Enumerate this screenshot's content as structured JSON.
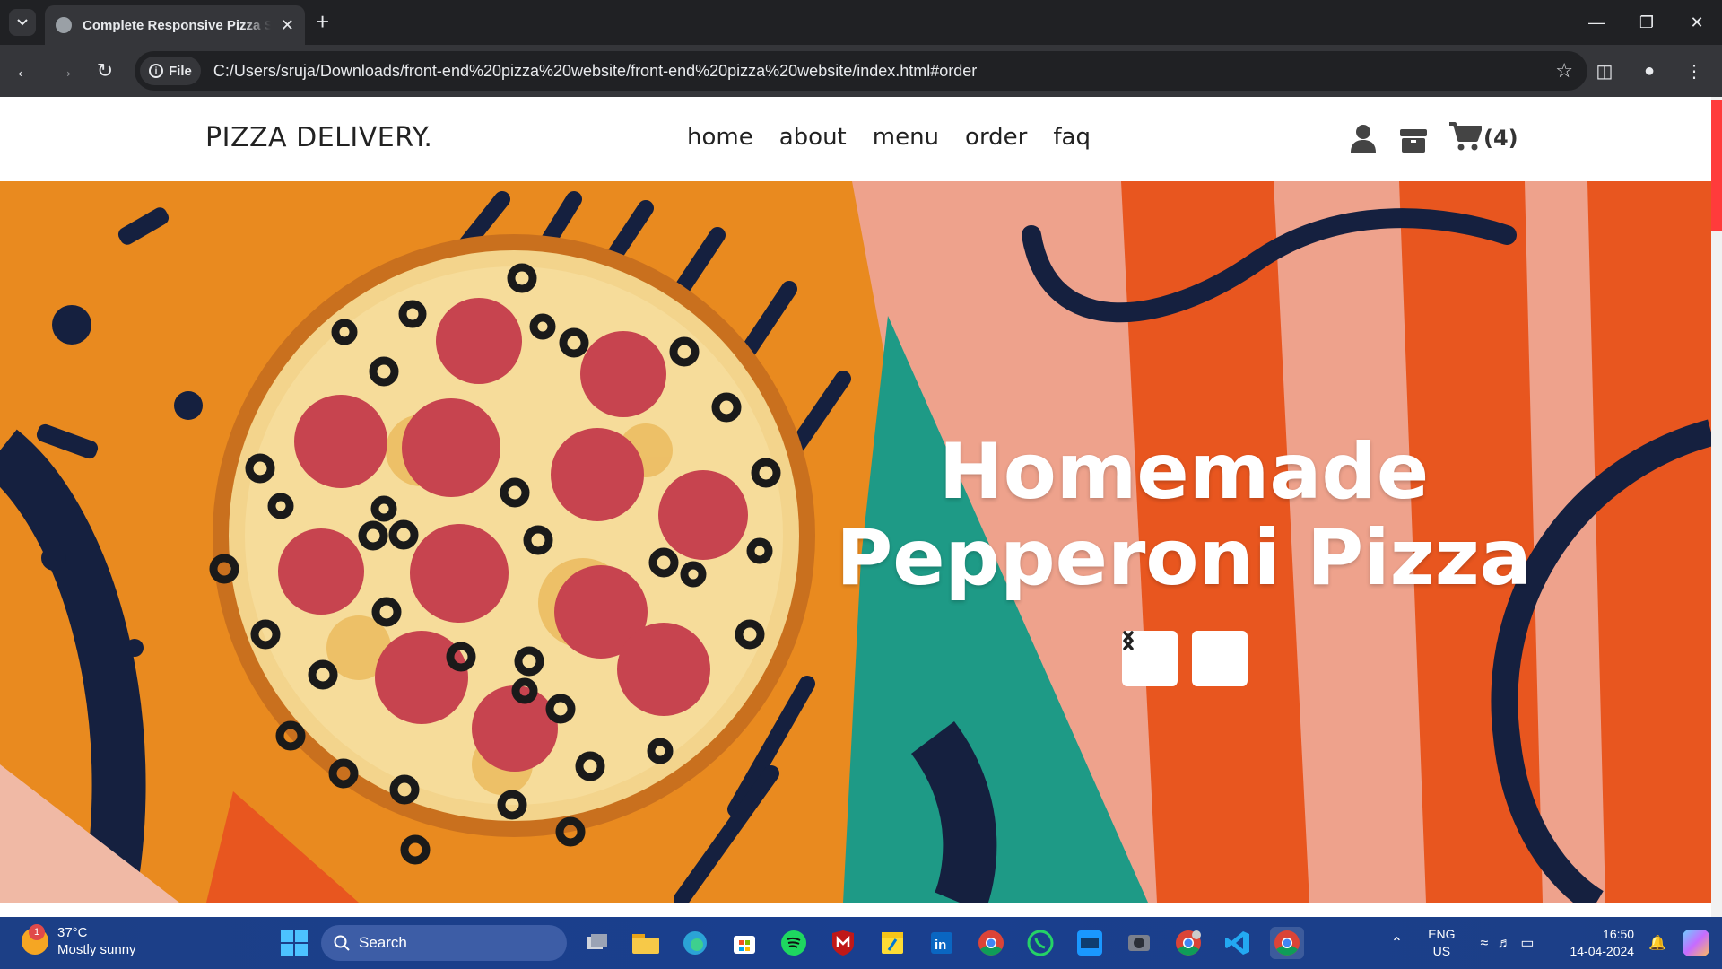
{
  "browser": {
    "tab_title": "Complete Responsive Pizza Shop",
    "new_tab": "+",
    "site_chip": "File",
    "url": "C:/Users/sruja/Downloads/front-end%20pizza%20website/front-end%20pizza%20website/index.html#order",
    "window_controls": [
      "minimize-icon",
      "restore-icon",
      "close-icon"
    ]
  },
  "site": {
    "logo": "PIZZA DELIVERY.",
    "nav": [
      "home",
      "about",
      "menu",
      "order",
      "faq"
    ],
    "icons": [
      "user-icon",
      "box-icon",
      "cart-icon"
    ],
    "cart_count": "(4)",
    "hero": {
      "title_line1": "Homemade",
      "title_line2": "Pepperoni Pizza",
      "prev_icon": "chevron-left-icon",
      "next_icon": "chevron-right-icon"
    }
  },
  "taskbar": {
    "weather_temp": "37°C",
    "weather_desc": "Mostly sunny",
    "weather_badge": "1",
    "search_label": "Search",
    "apps": [
      "task-view",
      "file-explorer",
      "edge",
      "microsoft-store",
      "spotify",
      "mcafee",
      "sticky-notes",
      "linkedin",
      "chrome",
      "whatsapp",
      "prime-video",
      "media-app",
      "chrome-profile",
      "vscode",
      "chrome-active"
    ],
    "lang_line1": "ENG",
    "lang_line2": "US",
    "time": "16:50",
    "date": "14-04-2024"
  },
  "colors": {
    "accent": "#ff3b3b",
    "taskbar": "#1a3f8f",
    "hero_orange": "#e8561f",
    "hero_teal": "#1e9a86",
    "hero_navy": "#15203f"
  }
}
